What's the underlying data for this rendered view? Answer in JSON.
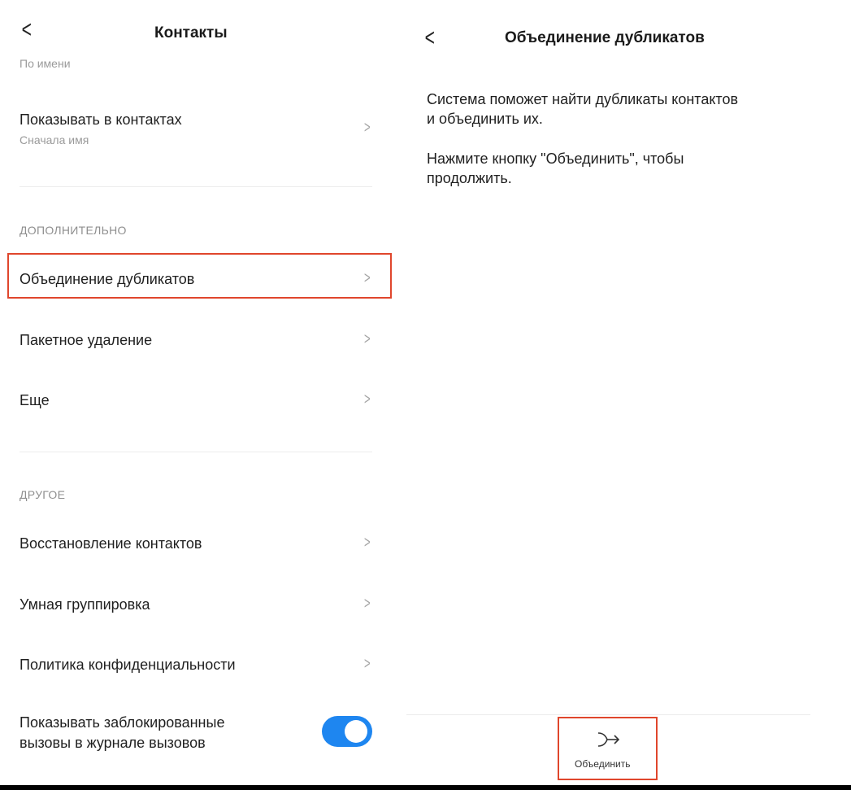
{
  "left": {
    "title": "Контакты",
    "top_partial_sub": "По имени",
    "show_in_contacts": {
      "label": "Показывать в контактах",
      "sub": "Сначала имя"
    },
    "section_additional": "ДОПОЛНИТЕЛЬНО",
    "merge_duplicates": "Объединение дубликатов",
    "batch_delete": "Пакетное удаление",
    "more": "Еще",
    "section_other": "ДРУГОЕ",
    "restore_contacts": "Восстановление контактов",
    "smart_grouping": "Умная группировка",
    "privacy_policy": "Политика конфиденциальности",
    "show_blocked": {
      "line1": "Показывать заблокированные",
      "line2": "вызовы в журнале вызовов"
    }
  },
  "right": {
    "title": "Объединение дубликатов",
    "para1_line1": "Система поможет найти дубликаты контактов",
    "para1_line2": "и объединить их.",
    "para2_line1": "Нажмите кнопку \"Объединить\", чтобы",
    "para2_line2": "продолжить.",
    "merge_button_label": "Объединить"
  },
  "colors": {
    "accent": "#1e86f0",
    "highlight": "#e0462c"
  },
  "toggle_show_blocked": true
}
